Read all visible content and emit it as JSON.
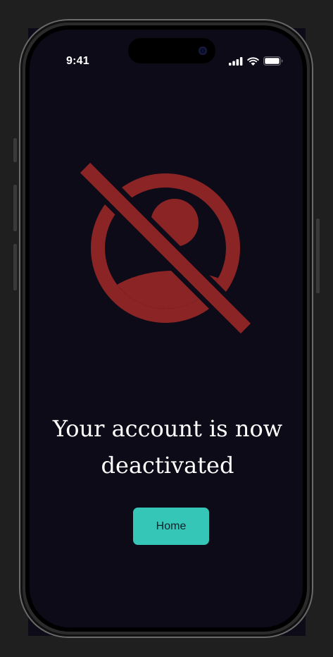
{
  "status_bar": {
    "time": "9:41"
  },
  "icons": {
    "blocked_user": "user-slash-icon",
    "signal": "cellular-signal-icon",
    "wifi": "wifi-icon",
    "battery": "battery-icon"
  },
  "colors": {
    "screen_background": "#0d0b18",
    "icon_red": "#8b2424",
    "button_teal": "#35c6b7",
    "text_white": "#ffffff"
  },
  "main": {
    "message": "Your account is now deactivated",
    "home_button_label": "Home"
  }
}
